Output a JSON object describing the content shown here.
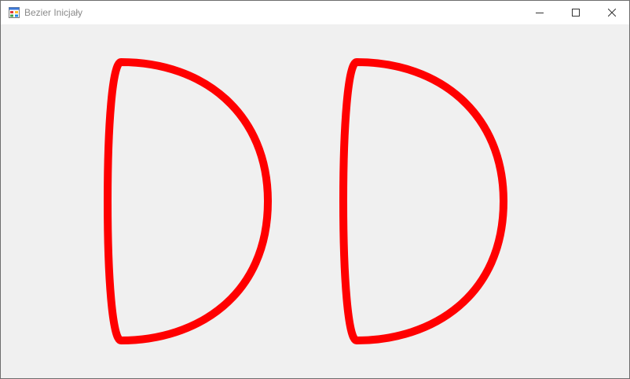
{
  "window": {
    "title": "Bezier Inicjały",
    "app_icon": "winforms-app-icon",
    "controls": {
      "minimize_icon": "minimize-icon",
      "maximize_icon": "maximize-icon",
      "close_icon": "close-icon"
    }
  },
  "canvas": {
    "background_color": "#f0f0f0",
    "stroke_color": "#ff0000",
    "shapes": [
      {
        "name": "letter-d-left",
        "glyph": "D"
      },
      {
        "name": "letter-d-right",
        "glyph": "D"
      }
    ]
  }
}
